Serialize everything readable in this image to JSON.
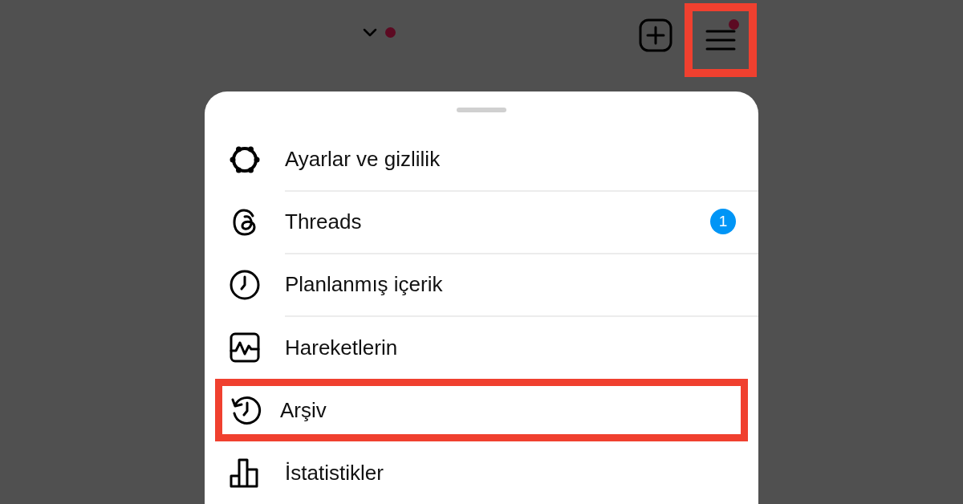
{
  "top_bar": {
    "account_switcher": {
      "has_notification": true
    },
    "menu_button": {
      "has_notification": true,
      "highlighted": true
    }
  },
  "menu": {
    "items": [
      {
        "kind": "settings",
        "label": "Ayarlar ve gizlilik",
        "highlighted": false
      },
      {
        "kind": "threads",
        "label": "Threads",
        "badge": "1",
        "highlighted": false
      },
      {
        "kind": "scheduled",
        "label": "Planlanmış içerik",
        "highlighted": false
      },
      {
        "kind": "activity",
        "label": "Hareketlerin",
        "highlighted": false
      },
      {
        "kind": "archive",
        "label": "Arşiv",
        "highlighted": true
      },
      {
        "kind": "insights",
        "label": "İstatistikler",
        "highlighted": false
      }
    ]
  }
}
